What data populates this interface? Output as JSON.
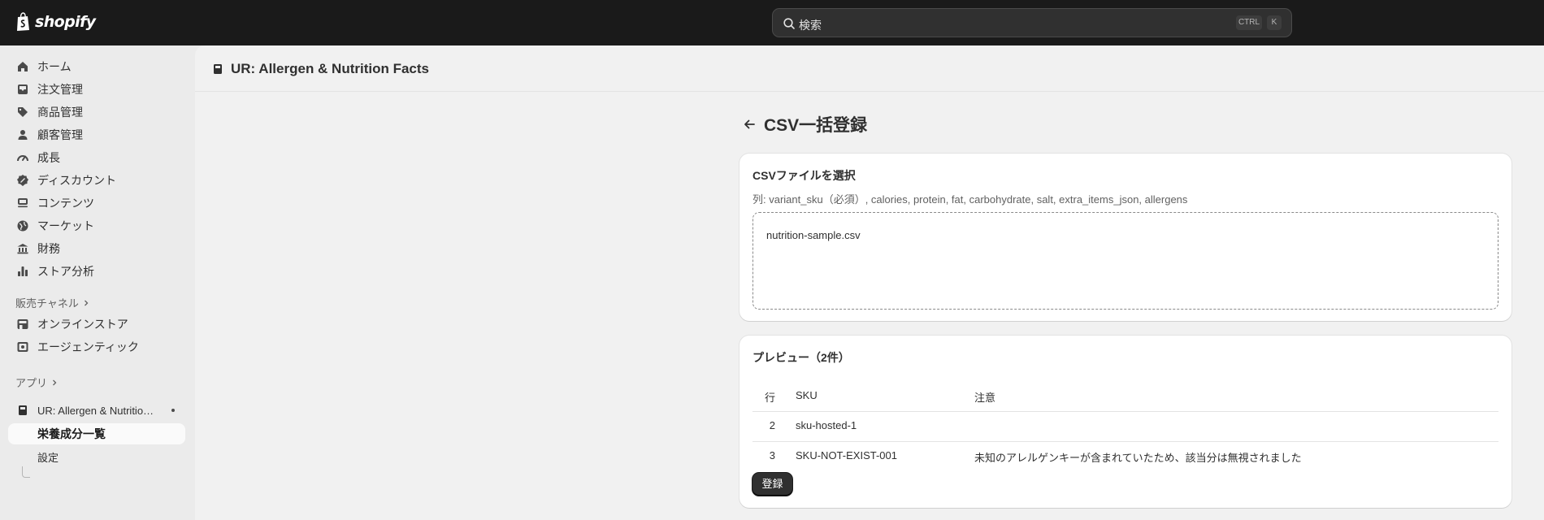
{
  "topbar": {
    "logo_text": "shopify",
    "search_placeholder": "検索",
    "shortcut_ctrl": "CTRL",
    "shortcut_k": "K"
  },
  "sidebar": {
    "items": [
      {
        "label": "ホーム",
        "icon": "home-icon"
      },
      {
        "label": "注文管理",
        "icon": "inbox-icon"
      },
      {
        "label": "商品管理",
        "icon": "tag-icon"
      },
      {
        "label": "顧客管理",
        "icon": "person-icon"
      },
      {
        "label": "成長",
        "icon": "gauge-icon"
      },
      {
        "label": "ディスカウント",
        "icon": "discount-icon"
      },
      {
        "label": "コンテンツ",
        "icon": "content-icon"
      },
      {
        "label": "マーケット",
        "icon": "globe-icon"
      },
      {
        "label": "財務",
        "icon": "bank-icon"
      },
      {
        "label": "ストア分析",
        "icon": "bar-chart-icon"
      }
    ],
    "sales_channels_title": "販売チャネル",
    "sales_channels": [
      {
        "label": "オンラインストア",
        "icon": "store-icon"
      },
      {
        "label": "エージェンティック",
        "icon": "agentic-icon"
      }
    ],
    "apps_title": "アプリ",
    "app": {
      "label": "UR: Allergen & Nutritio…",
      "sub_items": [
        {
          "label": "栄養成分一覧",
          "active": true
        },
        {
          "label": "設定",
          "active": false
        }
      ]
    }
  },
  "app_header": {
    "title": "UR: Allergen & Nutrition Facts"
  },
  "page": {
    "title": "CSV一括登録"
  },
  "upload_card": {
    "title": "CSVファイルを選択",
    "columns_hint": "列: variant_sku（必須）, calories, protein, fat, carbohydrate, salt, extra_items_json, allergens",
    "filename": "nutrition-sample.csv"
  },
  "preview_card": {
    "title": "プレビュー（2件）",
    "headers": {
      "row": "行",
      "sku": "SKU",
      "note": "注意"
    },
    "rows": [
      {
        "row": "2",
        "sku": "sku-hosted-1",
        "note": ""
      },
      {
        "row": "3",
        "sku": "SKU-NOT-EXIST-001",
        "note": "未知のアレルゲンキーが含まれていたため、該当分は無視されました"
      }
    ],
    "submit_label": "登録"
  },
  "colors": {
    "topbar_bg": "#1a1a1a",
    "sidebar_bg": "#ebebeb",
    "main_bg": "#f1f1f1",
    "card_bg": "#ffffff",
    "primary_button": "#303030"
  }
}
